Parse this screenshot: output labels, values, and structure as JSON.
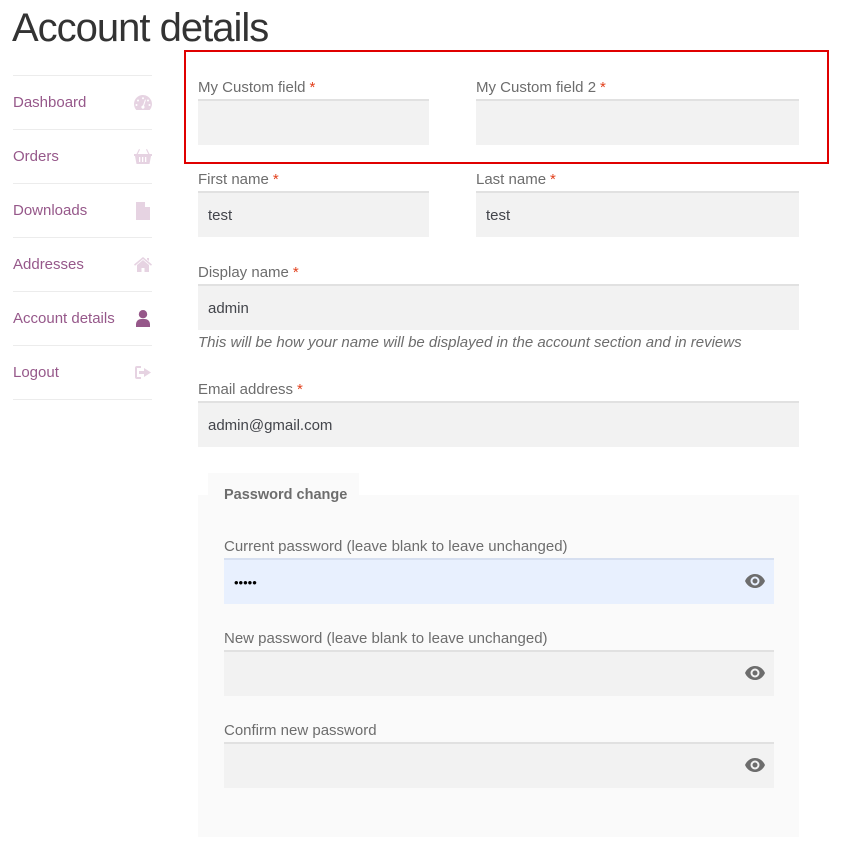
{
  "page": {
    "title": "Account details"
  },
  "nav": {
    "items": [
      {
        "label": "Dashboard",
        "icon": "dashboard-gauge-icon",
        "active": false
      },
      {
        "label": "Orders",
        "icon": "shopping-basket-icon",
        "active": false
      },
      {
        "label": "Downloads",
        "icon": "file-archive-icon",
        "active": false
      },
      {
        "label": "Addresses",
        "icon": "home-icon",
        "active": false
      },
      {
        "label": "Account details",
        "icon": "user-icon",
        "active": true
      },
      {
        "label": "Logout",
        "icon": "sign-out-icon",
        "active": false
      }
    ]
  },
  "form": {
    "required_marker": "*",
    "custom_field_1": {
      "label": "My Custom field",
      "value": ""
    },
    "custom_field_2": {
      "label": "My Custom field 2",
      "value": ""
    },
    "first_name": {
      "label": "First name",
      "value": "test"
    },
    "last_name": {
      "label": "Last name",
      "value": "test"
    },
    "display_name": {
      "label": "Display name",
      "value": "admin",
      "description": "This will be how your name will be displayed in the account section and in reviews"
    },
    "email": {
      "label": "Email address",
      "value": "admin@gmail.com"
    },
    "password_change": {
      "legend": "Password change",
      "current": {
        "label": "Current password (leave blank to leave unchanged)",
        "value": "•••••"
      },
      "new": {
        "label": "New password (leave blank to leave unchanged)",
        "value": ""
      },
      "confirm": {
        "label": "Confirm new password",
        "value": ""
      }
    }
  },
  "colors": {
    "accent": "#96588a",
    "required": "#e2401c",
    "highlight": "#e00000",
    "input_bg": "#f2f2f2",
    "autofill_bg": "#e8f0fe"
  }
}
